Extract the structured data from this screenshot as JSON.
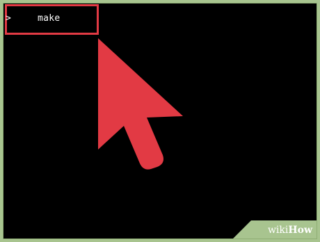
{
  "terminal": {
    "prompt_symbol": ">",
    "command": "make"
  },
  "colors": {
    "outer_background": "#a8c48f",
    "terminal_background": "#000000",
    "highlight": "#e23a44",
    "arrow": "#e23a44",
    "text": "#ffffff"
  },
  "icons": {
    "pointer": "cursor-arrow-icon"
  },
  "watermark": {
    "wiki": "wiki",
    "how": "How"
  }
}
